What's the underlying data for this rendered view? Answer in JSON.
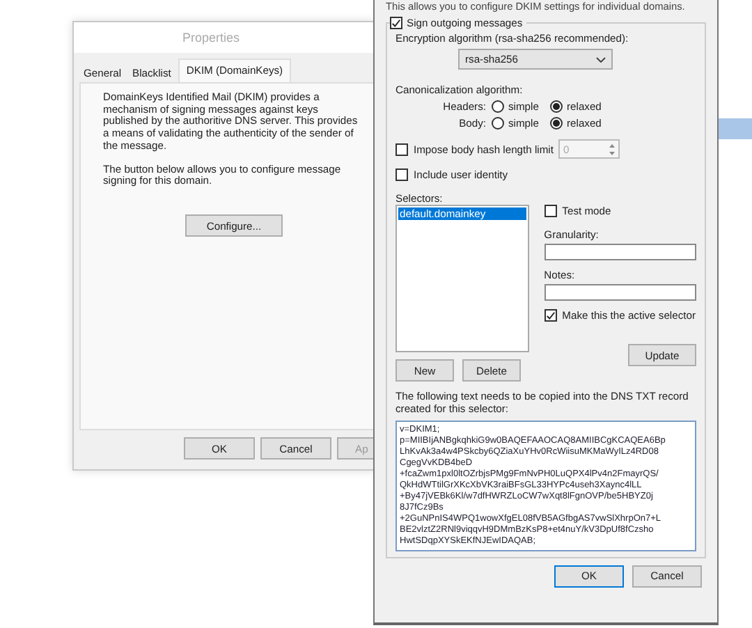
{
  "properties_window": {
    "title": "Properties",
    "tabs": [
      {
        "label": "General",
        "selected": false
      },
      {
        "label": "Blacklist",
        "selected": false
      },
      {
        "label": "DKIM (DomainKeys)",
        "selected": true
      }
    ],
    "description": "DomainKeys Identified Mail (DKIM) provides a mechanism of signing messages against keys published by the authoritive DNS server. This provides a means of validating the authenticity of the sender of the message.",
    "instruction": "The button below allows you to configure message signing for this domain.",
    "configure_button": "Configure...",
    "buttons": [
      "OK",
      "Cancel",
      "Ap"
    ]
  },
  "dkim_window": {
    "intro": "This allows you to configure DKIM settings for individual domains.",
    "sign_outgoing": {
      "label": "Sign outgoing messages",
      "checked": true
    },
    "encryption_label": "Encryption algorithm (rsa-sha256 recommended):",
    "encryption_value": "rsa-sha256",
    "canonicalization_label": "Canonicalization algorithm:",
    "canonicalization": [
      {
        "label": "Headers:",
        "options": [
          {
            "label": "simple",
            "selected": false
          },
          {
            "label": "relaxed",
            "selected": true
          }
        ]
      },
      {
        "label": "Body:",
        "options": [
          {
            "label": "simple",
            "selected": false
          },
          {
            "label": "relaxed",
            "selected": true
          }
        ]
      }
    ],
    "impose_limit": {
      "label": "Impose body hash length limit",
      "checked": false,
      "value": "0",
      "disabled": true
    },
    "include_identity": {
      "label": "Include user identity",
      "checked": false
    },
    "selectors_label": "Selectors:",
    "selectors": [
      {
        "label": "default.domainkey",
        "selected": true
      }
    ],
    "new_button": "New",
    "delete_button": "Delete",
    "test_mode": {
      "label": "Test mode",
      "checked": false
    },
    "granularity_label": "Granularity:",
    "notes_label": "Notes:",
    "active_selector": {
      "label": "Make this the active selector",
      "checked": true
    },
    "update_button": "Update",
    "dns_label": "The following text needs to be copied into the DNS TXT record created for this selector:",
    "dns_record": "v=DKIM1;\np=MIIBIjANBgkqhkiG9w0BAQEFAAOCAQ8AMIIBCgKCAQEA6Bp\nLhKvAk3a4w4PSkcby6QZiaXuYHv0RcWiisuMKMaWyILz4RD08\nCgegVvKDB4beD\n+fcaZwm1pxl0ltOZrbjsPMg9FmNvPH0LuQPX4lPv4n2FmayrQS/\nQkHdWTtilGrXKcXbVK3raiBFsGL33HYPc4useh3Xaync4lLL\n+By47jVEBk6Kl/w7dfHWRZLoCW7wXqt8lFgnOVP/be5HBYZ0j\n8J7fCz9Bs\n+2GuNPnIS4WPQ1wowXfgEL08fVB5AGfbgAS7vwSlXhrpOn7+L\nBE2vlztZ2RNl9viqqvH9DMmBzKsP8+et4nuY/kV3DpUf8fCzsho\nHwtSDqpXYSkEKfNJEwIDAQAB;",
    "buttons": [
      "OK",
      "Cancel"
    ]
  }
}
